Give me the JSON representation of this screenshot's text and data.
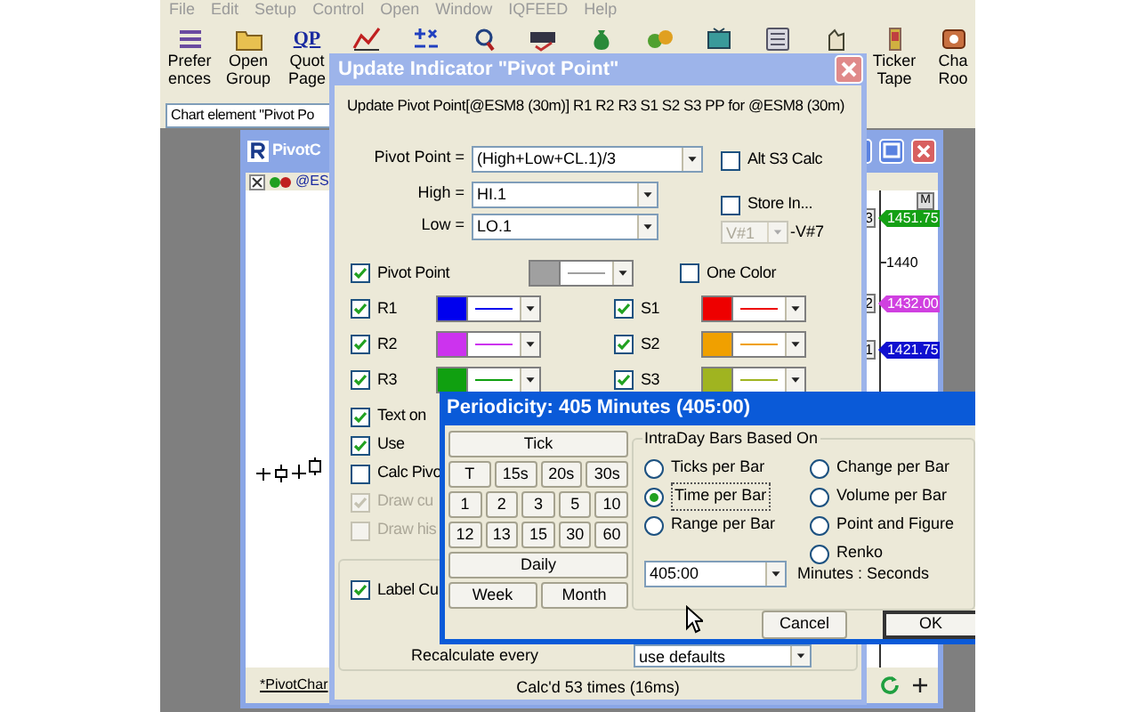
{
  "menu": [
    "File",
    "Edit",
    "Setup",
    "Control",
    "Open",
    "Window",
    "IQFEED",
    "Help"
  ],
  "toolbar": [
    {
      "kind": "labeled",
      "lines": [
        "Prefer",
        "ences"
      ]
    },
    {
      "kind": "labeled",
      "lines": [
        "Open",
        "Group"
      ]
    },
    {
      "kind": "labeled",
      "lines": [
        "Quot",
        "Page"
      ],
      "icon_text": "QP"
    },
    {
      "kind": "icon"
    },
    {
      "kind": "icon"
    },
    {
      "kind": "icon"
    },
    {
      "kind": "icon"
    },
    {
      "kind": "icon"
    },
    {
      "kind": "icon"
    },
    {
      "kind": "icon"
    },
    {
      "kind": "icon"
    },
    {
      "kind": "icon"
    },
    {
      "kind": "labeled",
      "lines": [
        "Ticker",
        "Tape"
      ]
    },
    {
      "kind": "labeled",
      "lines": [
        "Cha",
        "Roo"
      ]
    }
  ],
  "chart_element_field": {
    "value": "Chart element \"Pivot Po"
  },
  "chart_window": {
    "title": "PivotC",
    "symbol": "@ES",
    "axis_button": "M",
    "axis_labels": [
      "1440"
    ],
    "price_tags": [
      {
        "marker": "3",
        "text": "1451.75",
        "color": "#14a014"
      },
      {
        "marker": "2",
        "text": "1432.00",
        "color": "#d040e0"
      },
      {
        "marker": "1",
        "text": "1421.75",
        "color": "#1010d0"
      }
    ],
    "tab": "*PivotChar"
  },
  "indicator_dialog": {
    "title": "Update Indicator \"Pivot Point\"",
    "description": "Update Pivot Point[@ESM8 (30m)] R1 R2 R3 S1 S2 S3 PP for @ESM8 (30m)",
    "formula_fields": [
      {
        "label": "Pivot Point =",
        "value": "(High+Low+CL.1)/3"
      },
      {
        "label": "High =",
        "value": "HI.1"
      },
      {
        "label": "Low =",
        "value": "LO.1"
      }
    ],
    "alt_s3_calc": {
      "label": "Alt S3 Calc",
      "checked": false
    },
    "store_in": {
      "label": "Store In...",
      "checked": false
    },
    "store_from": {
      "value": "V#1",
      "disabled": true
    },
    "store_to": "-V#7",
    "pivot_line": {
      "label": "Pivot Point",
      "checked": true,
      "color": "#a0a0a0"
    },
    "one_color": {
      "label": "One Color",
      "checked": false
    },
    "levels": [
      {
        "r": {
          "label": "R1",
          "checked": true,
          "color": "#0000ee"
        },
        "s": {
          "label": "S1",
          "checked": true,
          "color": "#ee0000"
        }
      },
      {
        "r": {
          "label": "R2",
          "checked": true,
          "color": "#cc33ee"
        },
        "s": {
          "label": "S2",
          "checked": true,
          "color": "#f0a000"
        }
      },
      {
        "r": {
          "label": "R3",
          "checked": true,
          "color": "#10a010"
        },
        "s": {
          "label": "S3",
          "checked": true,
          "color": "#a0b420"
        }
      }
    ],
    "options": [
      {
        "label": "Text on",
        "checked": true,
        "disabled": false
      },
      {
        "label": "Use",
        "checked": true,
        "disabled": false
      },
      {
        "label": "Calc Pivo",
        "checked": false,
        "disabled": false
      },
      {
        "label": "Draw cu",
        "checked": true,
        "disabled": true
      },
      {
        "label": "Draw his",
        "checked": false,
        "disabled": true
      }
    ],
    "label_option": {
      "label": "Label Cu",
      "checked": true
    },
    "recalculate": {
      "label": "Recalculate every",
      "value": "use defaults"
    },
    "status": "Calc'd 53 times (16ms)"
  },
  "periodicity_dialog": {
    "title": "Periodicity: 405 Minutes (405:00)",
    "tick_button": "Tick",
    "second_buttons": [
      "T",
      "15s",
      "20s",
      "30s"
    ],
    "minute_rows": [
      [
        "1",
        "2",
        "3",
        "5",
        "10"
      ],
      [
        "12",
        "13",
        "15",
        "30",
        "60"
      ]
    ],
    "daily_button": "Daily",
    "week_month_buttons": [
      "Week",
      "Month"
    ],
    "group_title": "IntraDay Bars Based On",
    "bar_type_columns": [
      {
        "items": [
          {
            "label": "Ticks per Bar",
            "selected": false
          },
          {
            "label": "Time per Bar",
            "selected": true
          },
          {
            "label": "Range per Bar",
            "selected": false
          }
        ]
      },
      {
        "items": [
          {
            "label": "Change per Bar",
            "selected": false
          },
          {
            "label": "Volume per Bar",
            "selected": false
          },
          {
            "label": "Point and Figure",
            "selected": false
          },
          {
            "label": "Renko",
            "selected": false
          }
        ]
      }
    ],
    "interval": {
      "value": "405:00"
    },
    "interval_unit": "Minutes : Seconds",
    "buttons": [
      {
        "label": "Cancel",
        "default": false
      },
      {
        "label": "OK",
        "default": true
      }
    ]
  }
}
